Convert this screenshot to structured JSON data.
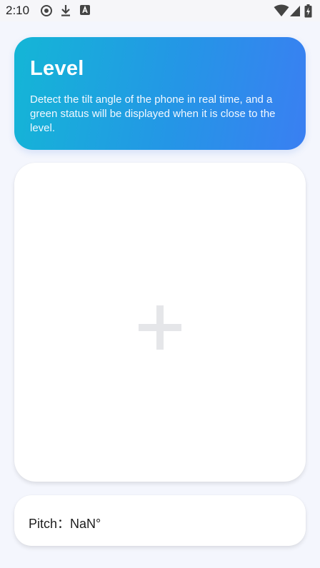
{
  "status_bar": {
    "time": "2:10",
    "icons_left": [
      "record-icon",
      "download-icon",
      "app-a-icon"
    ],
    "icons_right": [
      "wifi-icon",
      "cell-signal-icon",
      "battery-charging-icon"
    ]
  },
  "header": {
    "title": "Level",
    "description": "Detect the tilt angle of the phone in real time, and a green status will be displayed when it is close to the level."
  },
  "level_view": {
    "crosshair_icon": "plus-crosshair-icon"
  },
  "pitch": {
    "text": "Pitch：NaN°"
  },
  "colors": {
    "gradient_start": "#14b6d6",
    "gradient_end": "#3a7ff2",
    "background": "#f4f6fd",
    "card": "#ffffff",
    "crosshair": "#e5e6e9"
  }
}
